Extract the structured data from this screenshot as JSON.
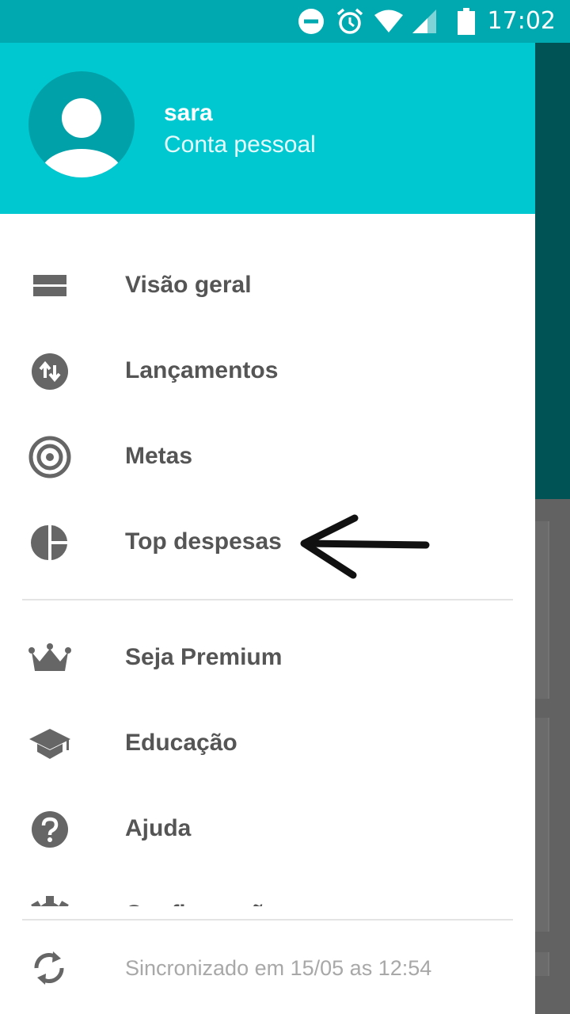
{
  "status_bar": {
    "time": "17:02",
    "icons": [
      "do-not-disturb-icon",
      "alarm-icon",
      "wifi-icon",
      "cellular-signal-icon",
      "battery-icon"
    ]
  },
  "header": {
    "user_name": "sara",
    "account_type": "Conta pessoal",
    "avatar_icon": "person-avatar-icon"
  },
  "menu": {
    "primary": [
      {
        "label": "Visão geral",
        "icon": "overview-icon"
      },
      {
        "label": "Lançamentos",
        "icon": "transactions-icon"
      },
      {
        "label": "Metas",
        "icon": "target-icon"
      },
      {
        "label": "Top despesas",
        "icon": "pie-chart-icon"
      }
    ],
    "secondary": [
      {
        "label": "Seja Premium",
        "icon": "crown-icon"
      },
      {
        "label": "Educação",
        "icon": "graduation-cap-icon"
      },
      {
        "label": "Ajuda",
        "icon": "help-icon"
      },
      {
        "label": "Configurações",
        "icon": "settings-icon"
      }
    ]
  },
  "footer": {
    "sync_text": "Sincronizado em 15/05 as 12:54",
    "icon": "sync-icon"
  },
  "colors": {
    "status_bar": "#00a9b0",
    "header": "#00c8d1",
    "menu_text": "#555555",
    "icon": "#666666"
  }
}
